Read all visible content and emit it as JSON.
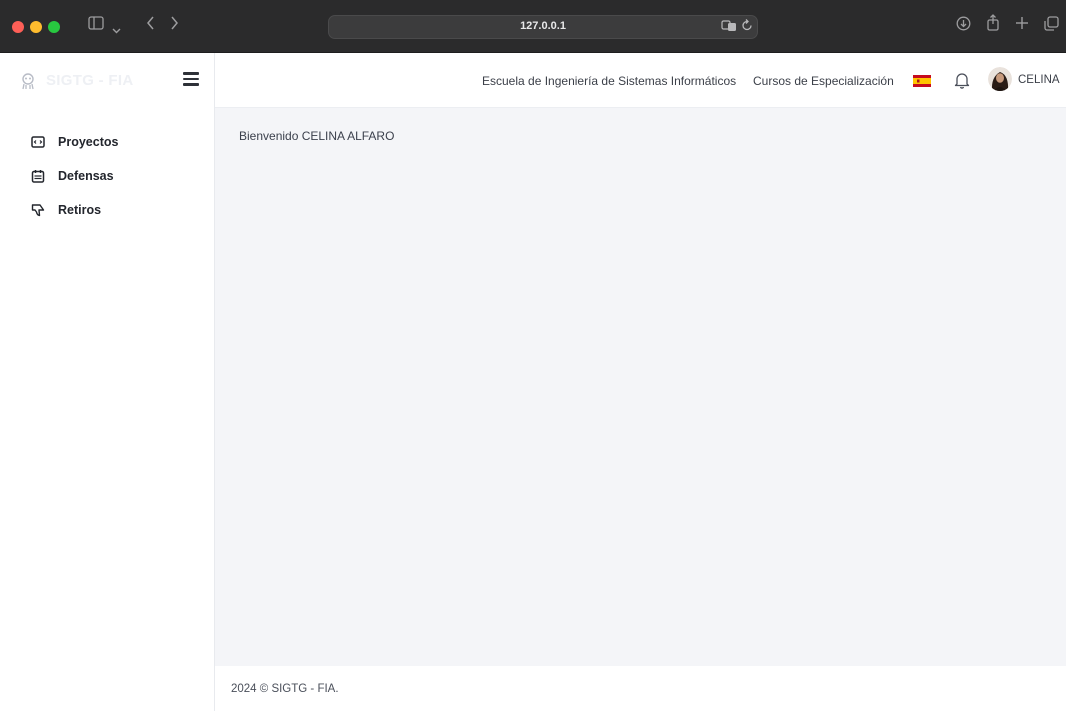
{
  "browser": {
    "url": "127.0.0.1",
    "icons": [
      "sidebar-toggle-icon",
      "back-icon",
      "forward-icon",
      "translate-icon",
      "reload-icon",
      "download-icon",
      "share-icon",
      "new-tab-icon",
      "tabs-overview-icon"
    ]
  },
  "sidebar": {
    "brand": "SIGTG - FIA",
    "items": [
      {
        "label": "Proyectos",
        "icon": "code-window-icon"
      },
      {
        "label": "Defensas",
        "icon": "calendar-icon"
      },
      {
        "label": "Retiros",
        "icon": "thumbs-down-icon"
      }
    ]
  },
  "header": {
    "links": [
      "Escuela de Ingeniería de Sistemas Informáticos",
      "Cursos de Especialización"
    ],
    "language_icon": "spain-flag-icon",
    "user_name": "CELINA"
  },
  "main": {
    "welcome": "Bienvenido CELINA ALFARO"
  },
  "footer": {
    "text": "2024 © SIGTG - FIA."
  },
  "colors": {
    "content_bg": "#f4f5f8",
    "chrome_bg": "#2b2b2c"
  }
}
